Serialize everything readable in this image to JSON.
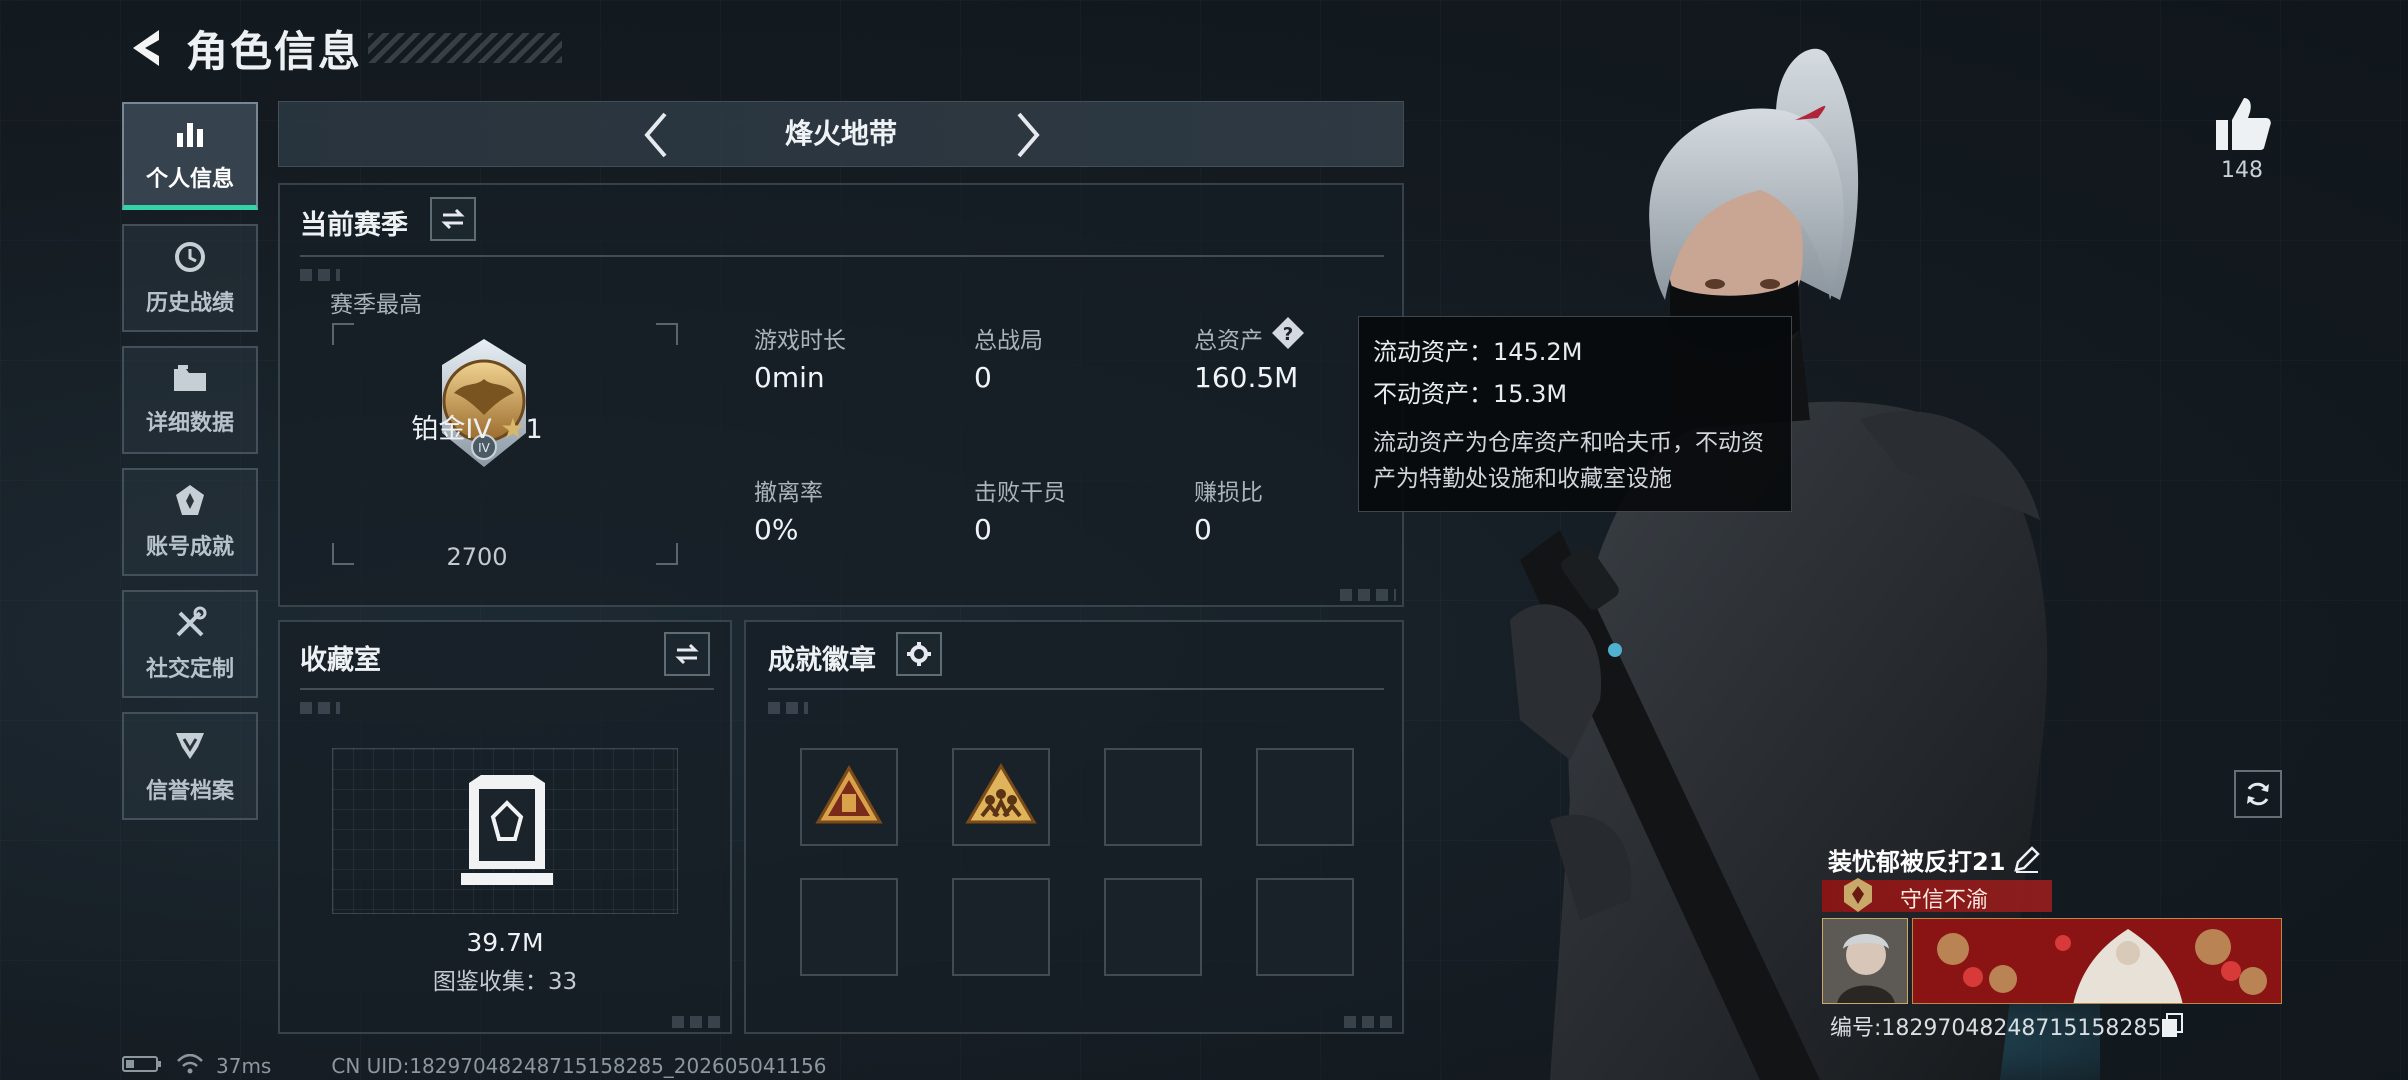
{
  "header": {
    "title": "角色信息"
  },
  "nav": {
    "items": [
      {
        "label": "个人信息",
        "icon": "bar-chart-icon",
        "active": true
      },
      {
        "label": "历史战绩",
        "icon": "history-icon",
        "active": false
      },
      {
        "label": "详细数据",
        "icon": "folder-icon",
        "active": false
      },
      {
        "label": "账号成就",
        "icon": "achievement-icon",
        "active": false
      },
      {
        "label": "社交定制",
        "icon": "tools-icon",
        "active": false
      },
      {
        "label": "信誉档案",
        "icon": "credit-icon",
        "active": false
      }
    ]
  },
  "mode": {
    "title": "烽火地带"
  },
  "season": {
    "title": "当前赛季",
    "best_label": "赛季最高",
    "rank_name": "铂金IV",
    "rank_stars": "1",
    "rank_score": "2700",
    "stats": {
      "play_time": {
        "label": "游戏时长",
        "value": "0min"
      },
      "total_matches": {
        "label": "总战局",
        "value": "0"
      },
      "total_assets": {
        "label": "总资产",
        "value": "160.5M"
      },
      "extract_rate": {
        "label": "撤离率",
        "value": "0%"
      },
      "kills": {
        "label": "击败干员",
        "value": "0"
      },
      "profit_ratio": {
        "label": "赚损比",
        "value": "0"
      }
    }
  },
  "tooltip": {
    "liquid": "流动资产：145.2M",
    "fixed": "不动资产：15.3M",
    "description": "流动资产为仓库资产和哈夫币，不动资产为特勤处设施和收藏室设施"
  },
  "collection": {
    "title": "收藏室",
    "value": "39.7M",
    "catalog": "图鉴收集：33"
  },
  "badges": {
    "title": "成就徽章",
    "slots_filled": 2,
    "slots_total": 8
  },
  "profile": {
    "likes": "148",
    "player_name": "装忧郁被反打21",
    "honor_title": "守信不渝",
    "player_id": "编号:182970482487151582​85"
  },
  "status": {
    "ping": "37ms",
    "uid": "CN UID:182970482487151582​85_202605041156"
  },
  "colors": {
    "accent": "#35d4a8",
    "banner_red": "#8c1414",
    "gold": "#c9a96a"
  }
}
